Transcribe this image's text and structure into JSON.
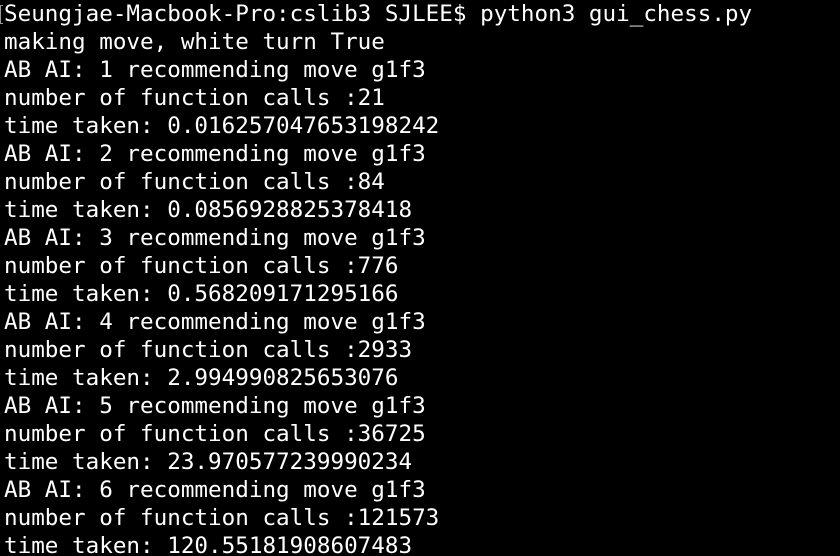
{
  "terminal": {
    "background": "#000000",
    "foreground": "#ffffff",
    "prompt": "Seungjae-Macbook-Pro:cslib3 SJLEE$ python3 gui_chess.py",
    "lines": [
      "making move, white turn True",
      "AB AI: 1 recommending move g1f3",
      "number of function calls :21",
      "time taken: 0.016257047653198242",
      "AB AI: 2 recommending move g1f3",
      "number of function calls :84",
      "time taken: 0.0856928825378418",
      "AB AI: 3 recommending move g1f3",
      "number of function calls :776",
      "time taken: 0.568209171295166",
      "AB AI: 4 recommending move g1f3",
      "number of function calls :2933",
      "time taken: 2.994990825653076",
      "AB AI: 5 recommending move g1f3",
      "number of function calls :36725",
      "time taken: 23.970577239990234",
      "AB AI: 6 recommending move g1f3",
      "number of function calls :121573",
      "time taken: 120.55181908607483"
    ]
  }
}
